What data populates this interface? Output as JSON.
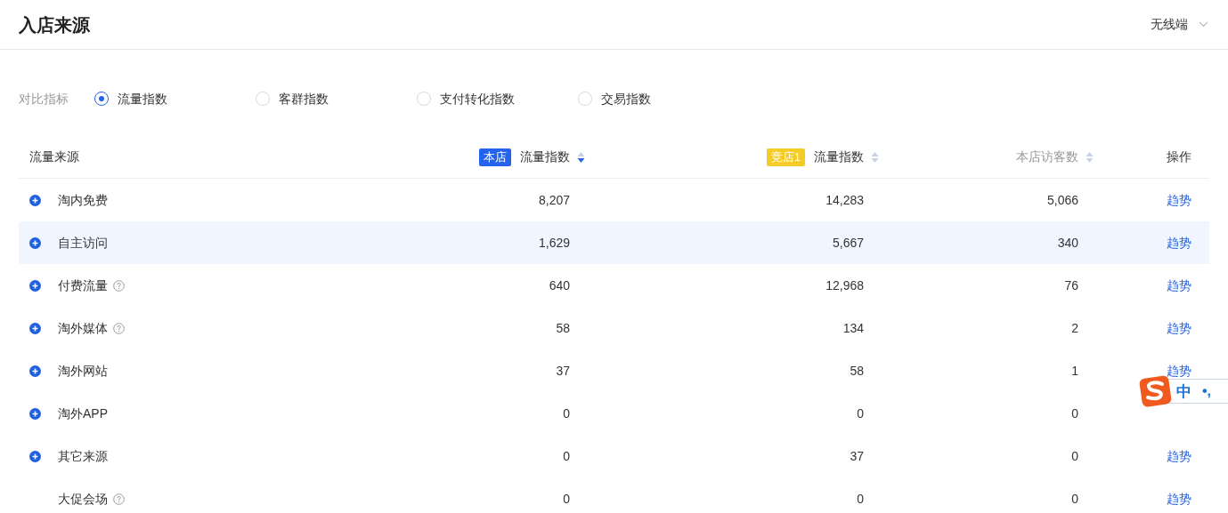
{
  "header": {
    "title": "入店来源",
    "platform": "无线端"
  },
  "compare": {
    "label": "对比指标",
    "options": [
      {
        "label": "流量指数",
        "selected": true
      },
      {
        "label": "客群指数",
        "selected": false
      },
      {
        "label": "支付转化指数",
        "selected": false
      },
      {
        "label": "交易指数",
        "selected": false
      }
    ]
  },
  "table": {
    "columns": [
      {
        "label": "流量来源",
        "kind": "name"
      },
      {
        "label": "流量指数",
        "tag": "本店",
        "color": "#2463eb",
        "sorted_desc": true,
        "muted": false,
        "kind": "metric"
      },
      {
        "label": "流量指数",
        "tag": "竞店1",
        "color": "#f5cb26",
        "sorted_desc": false,
        "muted": false,
        "kind": "metric"
      },
      {
        "label": "本店访客数",
        "sorted_desc": false,
        "muted": true,
        "kind": "metric"
      },
      {
        "label": "操作",
        "kind": "action"
      }
    ],
    "rows": [
      {
        "name": "淘内免费",
        "expandable": true,
        "help": false,
        "highlighted": false,
        "values": [
          "8,207",
          "14,283",
          "5,066"
        ],
        "action": "趋势"
      },
      {
        "name": "自主访问",
        "expandable": true,
        "help": false,
        "highlighted": true,
        "values": [
          "1,629",
          "5,667",
          "340"
        ],
        "action": "趋势"
      },
      {
        "name": "付费流量",
        "expandable": true,
        "help": true,
        "highlighted": false,
        "values": [
          "640",
          "12,968",
          "76"
        ],
        "action": "趋势"
      },
      {
        "name": "淘外媒体",
        "expandable": true,
        "help": true,
        "highlighted": false,
        "values": [
          "58",
          "134",
          "2"
        ],
        "action": "趋势"
      },
      {
        "name": "淘外网站",
        "expandable": true,
        "help": false,
        "highlighted": false,
        "values": [
          "37",
          "58",
          "1"
        ],
        "action": "趋势"
      },
      {
        "name": "淘外APP",
        "expandable": true,
        "help": false,
        "highlighted": false,
        "values": [
          "0",
          "0",
          "0"
        ]
      },
      {
        "name": "其它来源",
        "expandable": true,
        "help": false,
        "highlighted": false,
        "values": [
          "0",
          "37",
          "0"
        ],
        "action": "趋势"
      },
      {
        "name": "大促会场",
        "expandable": false,
        "help": true,
        "highlighted": false,
        "values": [
          "0",
          "0",
          "0"
        ],
        "action": "趋势"
      }
    ]
  },
  "ime_toolbar": {
    "mode": "中",
    "punctuation": "•,"
  }
}
